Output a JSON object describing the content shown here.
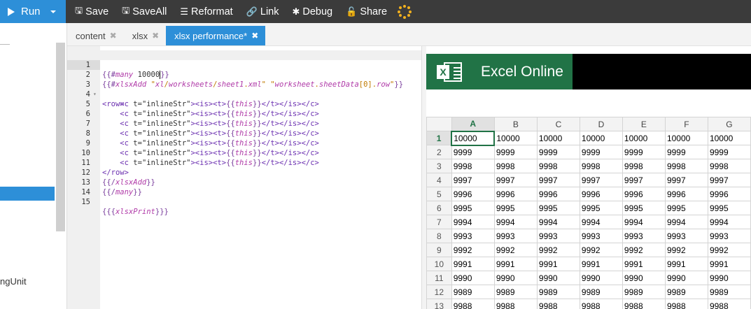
{
  "toolbar": {
    "run_label": "Run",
    "save_label": "Save",
    "saveall_label": "SaveAll",
    "reformat_label": "Reformat",
    "link_label": "Link",
    "debug_label": "Debug",
    "share_label": "Share"
  },
  "sidebar": {
    "partial_item_label": "ngUnit"
  },
  "tabs": [
    {
      "label": "content",
      "active": false
    },
    {
      "label": "xlsx",
      "active": false
    },
    {
      "label": "xlsx performance*",
      "active": true
    }
  ],
  "editor": {
    "line_numbers": [
      "1",
      "2",
      "3",
      "4",
      "5",
      "6",
      "7",
      "8",
      "9",
      "10",
      "11",
      "12",
      "13",
      "14",
      "15"
    ]
  },
  "excel": {
    "app_title": "Excel Online",
    "logo_letter": "X",
    "columns": [
      "A",
      "B",
      "C",
      "D",
      "E",
      "F",
      "G"
    ],
    "rows": [
      {
        "n": "1",
        "v": "10000"
      },
      {
        "n": "2",
        "v": "9999"
      },
      {
        "n": "3",
        "v": "9998"
      },
      {
        "n": "4",
        "v": "9997"
      },
      {
        "n": "5",
        "v": "9996"
      },
      {
        "n": "6",
        "v": "9995"
      },
      {
        "n": "7",
        "v": "9994"
      },
      {
        "n": "8",
        "v": "9993"
      },
      {
        "n": "9",
        "v": "9992"
      },
      {
        "n": "10",
        "v": "9991"
      },
      {
        "n": "11",
        "v": "9990"
      },
      {
        "n": "12",
        "v": "9989"
      },
      {
        "n": "13",
        "v": "9988"
      }
    ],
    "active_col": "A",
    "active_row": "1",
    "brand_color": "#217346"
  },
  "colors": {
    "accent": "#2d8fd8",
    "toolbar_bg": "#3b3b3b",
    "spinner": "#f2b01e"
  }
}
